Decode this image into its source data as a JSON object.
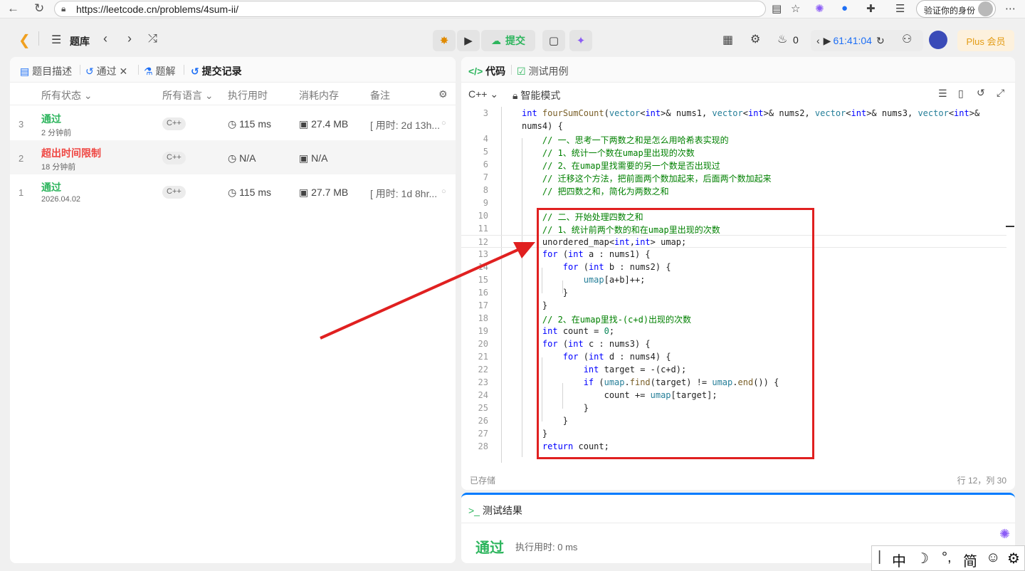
{
  "browser": {
    "url": "https://leetcode.cn/problems/4sum-ii/",
    "verify_label": "验证你的身份"
  },
  "header": {
    "problem_bank": "题库",
    "submit_label": "提交",
    "counter": "0",
    "timer": "61:41:04",
    "plus_label": "Plus 会员"
  },
  "left_tabs": {
    "description": "题目描述",
    "accepted": "通过",
    "solutions": "题解",
    "submissions": "提交记录"
  },
  "table": {
    "headers": {
      "status": "所有状态",
      "language": "所有语言",
      "runtime": "执行用时",
      "memory": "消耗内存",
      "notes": "备注"
    },
    "rows": [
      {
        "index": "3",
        "status": "通过",
        "status_kind": "ok",
        "time": "2 分钟前",
        "language": "C++",
        "runtime": "115 ms",
        "memory": "27.4 MB",
        "note": "[ 用时: 2d 13h..."
      },
      {
        "index": "2",
        "status": "超出时间限制",
        "status_kind": "bad",
        "time": "18 分钟前",
        "language": "C++",
        "runtime": "N/A",
        "memory": "N/A",
        "note": ""
      },
      {
        "index": "1",
        "status": "通过",
        "status_kind": "ok",
        "time": "2026.04.02",
        "language": "C++",
        "runtime": "115 ms",
        "memory": "27.7 MB",
        "note": "[ 用时: 1d 8hr..."
      }
    ]
  },
  "code_tabs": {
    "code": "代码",
    "testcase": "测试用例"
  },
  "editor": {
    "language": "C++",
    "mode": "智能模式",
    "saved": "已存储",
    "cursor_pos": "行 12，列 30",
    "lines": [
      {
        "n": "3",
        "html": "<span class=\"kw\">int</span> <span class=\"fn\">fourSumCount</span>(<span class=\"typ\">vector</span>&lt;<span class=\"kw\">int</span>&gt;&amp; nums1, <span class=\"typ\">vector</span>&lt;<span class=\"kw\">int</span>&gt;&amp; nums2, <span class=\"typ\">vector</span>&lt;<span class=\"kw\">int</span>&gt;&amp; nums3, <span class=\"typ\">vector</span>&lt;<span class=\"kw\">int</span>&gt;&amp;"
      },
      {
        "n": "",
        "html": "nums4) {"
      },
      {
        "n": "4",
        "html": "    <span class=\"cm\">// 一、思考一下两数之和是怎么用哈希表实现的</span>"
      },
      {
        "n": "5",
        "html": "    <span class=\"cm\">// 1、统计一个数在umap里出现的次数</span>"
      },
      {
        "n": "6",
        "html": "    <span class=\"cm\">// 2、在umap里找需要的另一个数是否出现过</span>"
      },
      {
        "n": "7",
        "html": "    <span class=\"cm\">// 迁移这个方法，把前面两个数加起来，后面两个数加起来</span>"
      },
      {
        "n": "8",
        "html": "    <span class=\"cm\">// 把四数之和，简化为两数之和</span>"
      },
      {
        "n": "9",
        "html": ""
      },
      {
        "n": "10",
        "html": "    <span class=\"cm\">// 二、开始处理四数之和</span>"
      },
      {
        "n": "11",
        "html": "    <span class=\"cm\">// 1、统计前两个数的和在umap里出现的次数</span>"
      },
      {
        "n": "12",
        "html": "    unordered_map&lt;<span class=\"kw\">int</span>,<span class=\"kw\">int</span>&gt; umap;"
      },
      {
        "n": "13",
        "html": "    <span class=\"kw\">for</span> (<span class=\"kw\">int</span> a : nums1) {"
      },
      {
        "n": "14",
        "html": "        <span class=\"kw\">for</span> (<span class=\"kw\">int</span> b : nums2) {"
      },
      {
        "n": "15",
        "html": "            <span class=\"typ\">umap</span>[a+b]++;"
      },
      {
        "n": "16",
        "html": "        }"
      },
      {
        "n": "17",
        "html": "    }"
      },
      {
        "n": "18",
        "html": "    <span class=\"cm\">// 2、在umap里找-(c+d)出现的次数</span>"
      },
      {
        "n": "19",
        "html": "    <span class=\"kw\">int</span> count = <span class=\"num\">0</span>;"
      },
      {
        "n": "20",
        "html": "    <span class=\"kw\">for</span> (<span class=\"kw\">int</span> c : nums3) {"
      },
      {
        "n": "21",
        "html": "        <span class=\"kw\">for</span> (<span class=\"kw\">int</span> d : nums4) {"
      },
      {
        "n": "22",
        "html": "            <span class=\"kw\">int</span> target = -(c+d);"
      },
      {
        "n": "23",
        "html": "            <span class=\"kw\">if</span> (<span class=\"typ\">umap</span>.<span class=\"fn\">find</span>(target) != <span class=\"typ\">umap</span>.<span class=\"fn\">end</span>()) {"
      },
      {
        "n": "24",
        "html": "                count += <span class=\"typ\">umap</span>[target];"
      },
      {
        "n": "25",
        "html": "            }"
      },
      {
        "n": "26",
        "html": "        }"
      },
      {
        "n": "27",
        "html": "    }"
      },
      {
        "n": "28",
        "html": "    <span class=\"kw\">return</span> count;"
      }
    ]
  },
  "result": {
    "title": "测试结果",
    "status": "通过",
    "runtime": "执行用时: 0 ms"
  },
  "ime": {
    "chars": [
      "中",
      "☽",
      "°,",
      "简",
      "☺",
      "⚙"
    ]
  },
  "colors": {
    "accepted": "#2db55d",
    "error": "#ef4743",
    "annotation": "#e02020",
    "submit": "#2db55d"
  }
}
